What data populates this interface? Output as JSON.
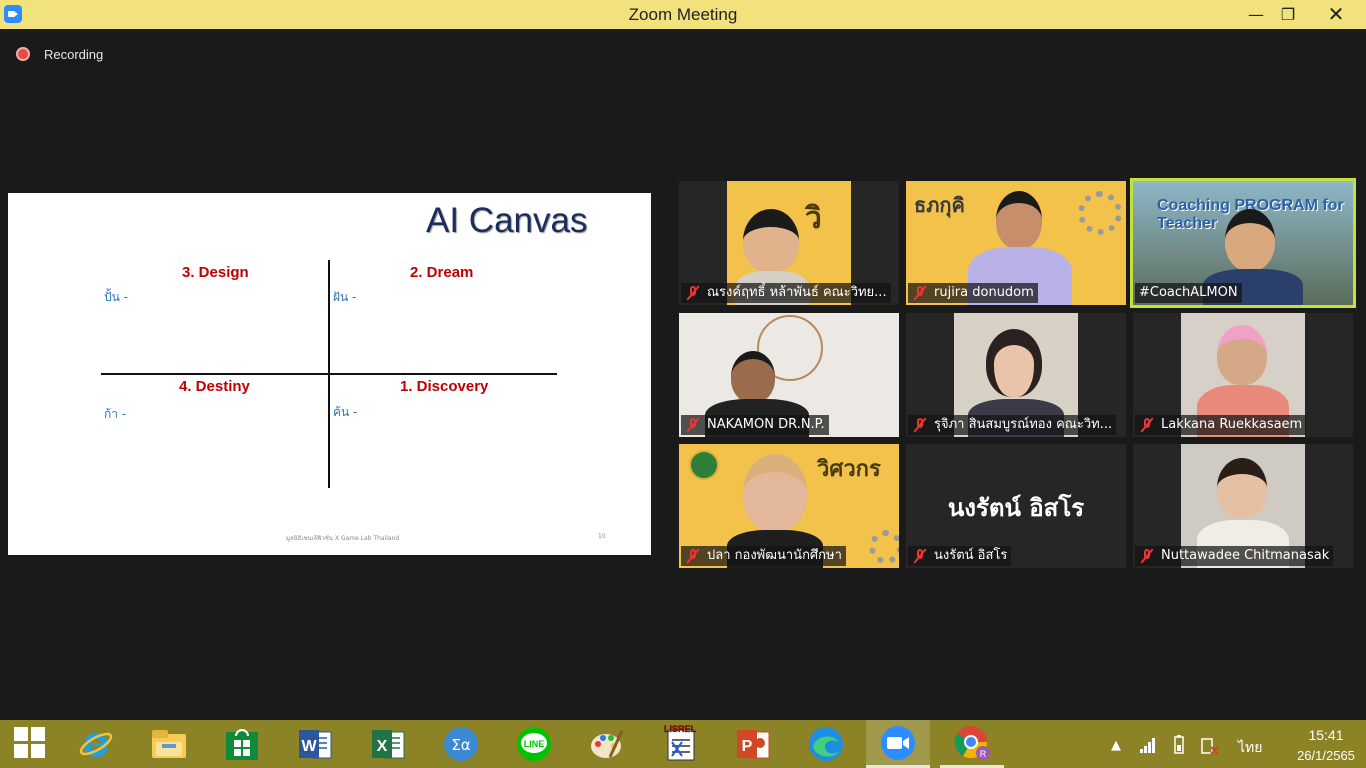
{
  "window": {
    "title": "Zoom Meeting"
  },
  "recording": {
    "label": "Recording"
  },
  "slide": {
    "title": "AI Canvas",
    "quadrants": [
      {
        "heading": "3. Design",
        "sub": "ปั้น -"
      },
      {
        "heading": "2. Dream",
        "sub": "ฝัน -"
      },
      {
        "heading": "4. Destiny",
        "sub": "ก้า -"
      },
      {
        "heading": "1. Discovery",
        "sub": "ค้น -"
      }
    ],
    "footer": "มูลนิธิเชนเจ้ฟิวชั่น X Game Lab Thailand",
    "page_number": "10"
  },
  "participants": [
    {
      "name": "ณรงค์ฤทธิ์ หล้าพันธ์ คณะวิทย...",
      "muted": true
    },
    {
      "name": "rujira donudom",
      "muted": true
    },
    {
      "name": "#CoachALMON",
      "muted": false,
      "active_speaker": true,
      "banner": "Coaching PROGRAM for Teacher"
    },
    {
      "name": "NAKAMON DR.N.P.",
      "muted": true
    },
    {
      "name": "รุจิภา สินสมบูรณ์ทอง คณะวิท...",
      "muted": true
    },
    {
      "name": "Lakkana Ruekkasaem",
      "muted": true
    },
    {
      "name": "ปลา กองพัฒนานักศึกษา",
      "muted": true
    },
    {
      "name": "นงรัตน์ อิสโร",
      "muted": true,
      "video_off": true,
      "display_text": "นงรัตน์ อิสโร"
    },
    {
      "name": "Nuttawadee Chitmanasak",
      "muted": true
    }
  ],
  "taskbar": {
    "apps": [
      {
        "name": "internet-explorer-icon"
      },
      {
        "name": "file-explorer-icon"
      },
      {
        "name": "store-icon"
      },
      {
        "name": "word-icon",
        "letter": "W"
      },
      {
        "name": "excel-icon",
        "letter": "X"
      },
      {
        "name": "math-input-icon",
        "letter": "Σα"
      },
      {
        "name": "line-icon",
        "letter": "LINE"
      },
      {
        "name": "paint-icon"
      },
      {
        "name": "lisrel-icon",
        "letter": "LISREL"
      },
      {
        "name": "powerpoint-icon",
        "letter": "P"
      },
      {
        "name": "edge-icon"
      },
      {
        "name": "zoom-icon"
      },
      {
        "name": "chrome-icon"
      }
    ],
    "tray": {
      "language": "ไทย",
      "time": "15:41",
      "date": "26/1/2565"
    }
  },
  "colors": {
    "title_bar": "#f2e27d",
    "taskbar": "#8b8325",
    "active_speaker_border": "#c2e13a",
    "slide_heading": "#c00000",
    "slide_sub": "#2e74b5"
  }
}
